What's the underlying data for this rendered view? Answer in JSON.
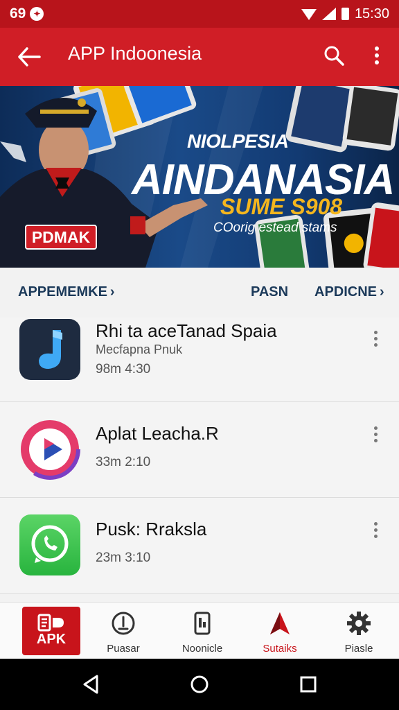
{
  "status_bar": {
    "left_text": "69",
    "time": "15:30"
  },
  "app_bar": {
    "title": "APP Indoonesia"
  },
  "banner": {
    "badge": "PDMAK",
    "kicker": "NIOLPESIA",
    "title": "AINDANASIA",
    "promo": "SUME S908",
    "subtitle": "COorig estead stams"
  },
  "tabs": [
    {
      "label": "APPEMEMKE"
    },
    {
      "label": "PASN"
    },
    {
      "label": "APDICNE"
    }
  ],
  "apps": [
    {
      "name": "Rhi ta aceTanad Spaia",
      "subtitle": "Mecfapna Pnuk",
      "meta": "98m  4:30"
    },
    {
      "name": "Aplat Leacha.R",
      "subtitle": "",
      "meta": "33m  2:10"
    },
    {
      "name": "Pusk: Rraksla",
      "subtitle": "",
      "meta": "23m  3:10"
    }
  ],
  "bottom_nav": [
    {
      "label": "APK"
    },
    {
      "label": "Puasar"
    },
    {
      "label": "Noonicle"
    },
    {
      "label": "Sutaiks"
    },
    {
      "label": "Piasle"
    }
  ],
  "colors": {
    "primary": "#d01e26",
    "status": "#b8141b",
    "accent_gold": "#f4b61e"
  }
}
